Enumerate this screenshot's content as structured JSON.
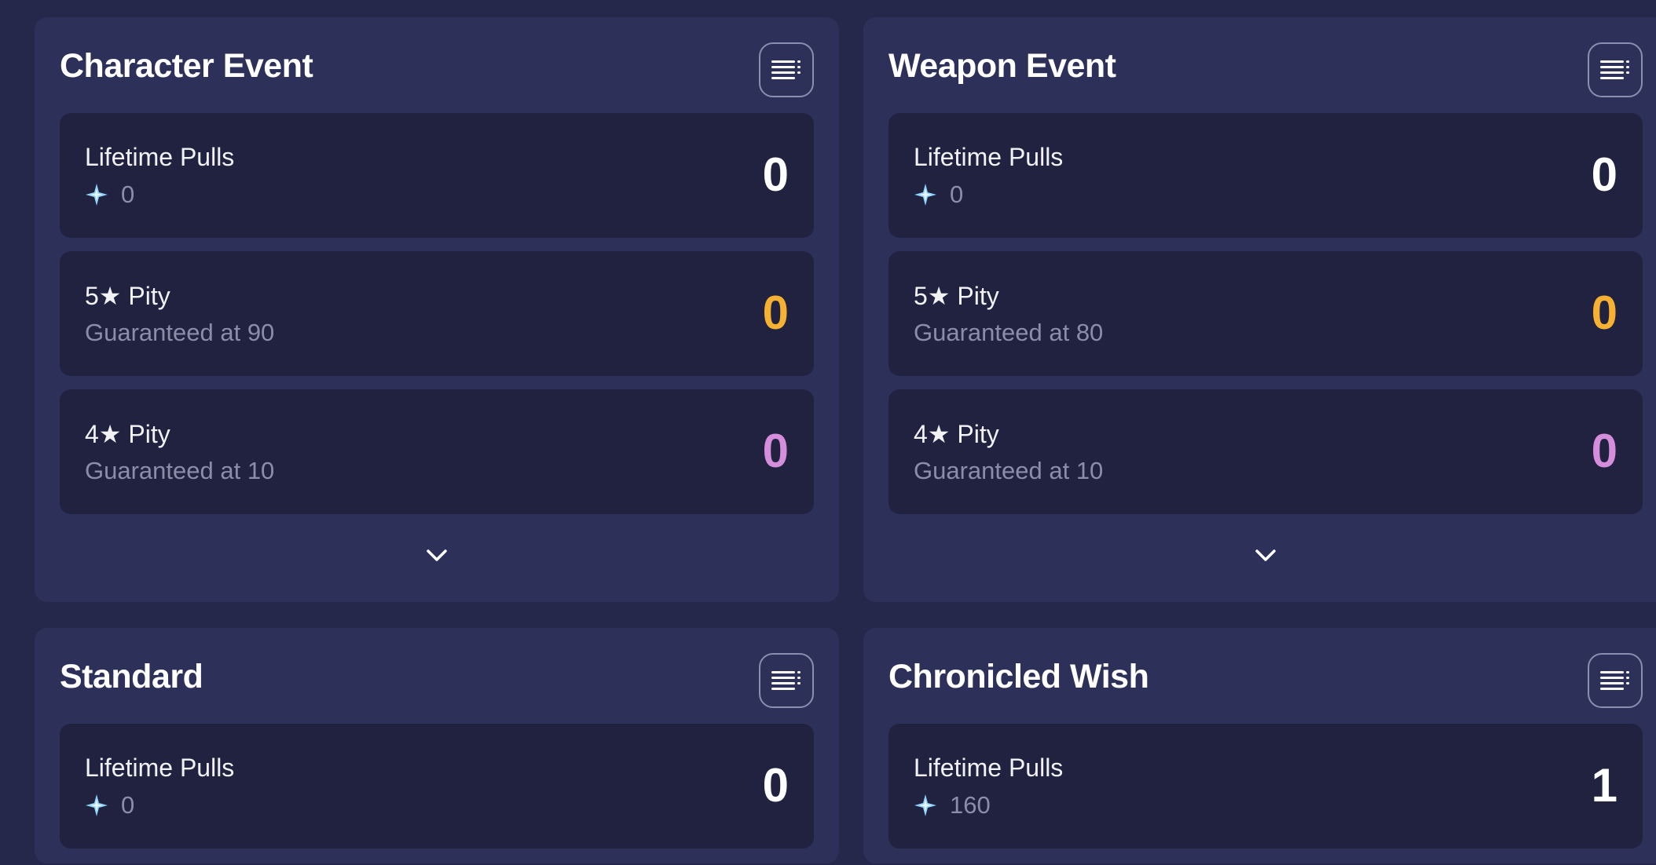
{
  "colors": {
    "background": "#25284a",
    "panel": "#2d3159",
    "row": "#202240",
    "pity5": "#f6b133",
    "pity4": "#d48edc",
    "gem": "#8fd3ff"
  },
  "icons": {
    "menu": "list-menu-icon",
    "gem": "primogem-icon",
    "expand": "chevron-down-icon"
  },
  "panels": [
    {
      "title": "Character Event",
      "rows": [
        {
          "label": "Lifetime Pulls",
          "sub": "0",
          "value": "0"
        },
        {
          "label": "5★ Pity",
          "sub": "Guaranteed at 90",
          "value": "0"
        },
        {
          "label": "4★ Pity",
          "sub": "Guaranteed at 10",
          "value": "0"
        }
      ]
    },
    {
      "title": "Weapon Event",
      "rows": [
        {
          "label": "Lifetime Pulls",
          "sub": "0",
          "value": "0"
        },
        {
          "label": "5★ Pity",
          "sub": "Guaranteed at 80",
          "value": "0"
        },
        {
          "label": "4★ Pity",
          "sub": "Guaranteed at 10",
          "value": "0"
        }
      ]
    },
    {
      "title": "Standard",
      "rows": [
        {
          "label": "Lifetime Pulls",
          "sub": "0",
          "value": "0"
        }
      ]
    },
    {
      "title": "Chronicled Wish",
      "rows": [
        {
          "label": "Lifetime Pulls",
          "sub": "160",
          "value": "1"
        }
      ]
    }
  ]
}
